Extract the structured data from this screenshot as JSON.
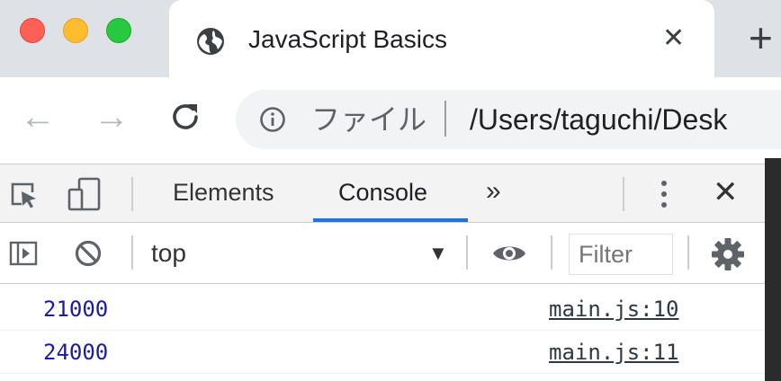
{
  "window": {
    "tab_title": "JavaScript Basics",
    "tab_close": "✕",
    "new_tab": "+",
    "tab_icon": "globe-icon"
  },
  "toolbar": {
    "back": "←",
    "forward": "→",
    "reload_icon": "reload-icon",
    "info_icon": "info-icon",
    "scheme_label": "ファイル",
    "url": "/Users/taguchi/Desk"
  },
  "devtools": {
    "tabs": [
      {
        "label": "Elements",
        "active": false
      },
      {
        "label": "Console",
        "active": true
      }
    ],
    "more_tabs": "»",
    "close": "✕",
    "accent_color": "#1a73e8"
  },
  "console_bar": {
    "context": "top",
    "context_arrow": "▼",
    "filter_placeholder": "Filter"
  },
  "messages": [
    {
      "value": "21000",
      "source": "main.js:10"
    },
    {
      "value": "24000",
      "source": "main.js:11"
    }
  ]
}
